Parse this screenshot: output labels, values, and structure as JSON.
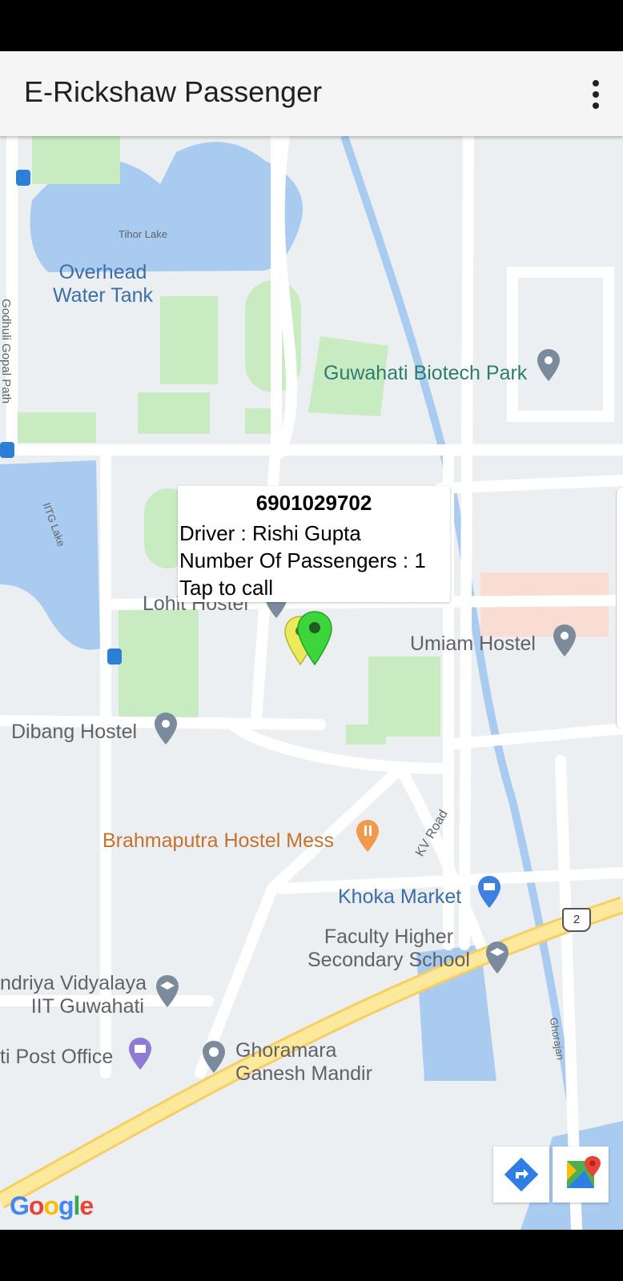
{
  "app": {
    "title": "E-Rickshaw Passenger",
    "menu_icon": "more-vert-icon"
  },
  "map": {
    "labels": {
      "tihor_lake": "Tihor Lake",
      "overhead_tank": "Overhead\nWater Tank",
      "godhuli": "Godhuli Gopal Path",
      "biotech": "Guwahati Biotech Park",
      "iitg_lake": "IITG Lake",
      "lohit": "Lohit Hostel",
      "umiam": "Umiam Hostel",
      "dibang": "Dibang Hostel",
      "brahmaputra": "Brahmaputra Hostel Mess",
      "kv_road": "KV Road",
      "khoka": "Khoka Market",
      "faculty": "Faculty Higher\nSecondary School",
      "vidyalaya": "ndriya Vidyalaya\nIIT Guwahati",
      "post_office": "ti Post Office",
      "ganesh": "Ghoramara\nGanesh Mandir",
      "ghorajan": "Ghorajan",
      "highway_shield": "2"
    },
    "colors": {
      "water": "#a8cbef",
      "park": "#c9ebc1",
      "road": "#ffffff",
      "highway": "#fde99b",
      "background": "#eceff1"
    },
    "info_window": {
      "title": "6901029702",
      "driver": "Driver : Rishi Gupta",
      "passengers": "Number Of Passengers : 1",
      "action": "Tap to call"
    },
    "markers": [
      "yellow-marker",
      "green-marker"
    ],
    "toolbar": {
      "directions_icon": "directions-icon",
      "maps_icon": "google-maps-icon"
    },
    "logo": "Google"
  }
}
